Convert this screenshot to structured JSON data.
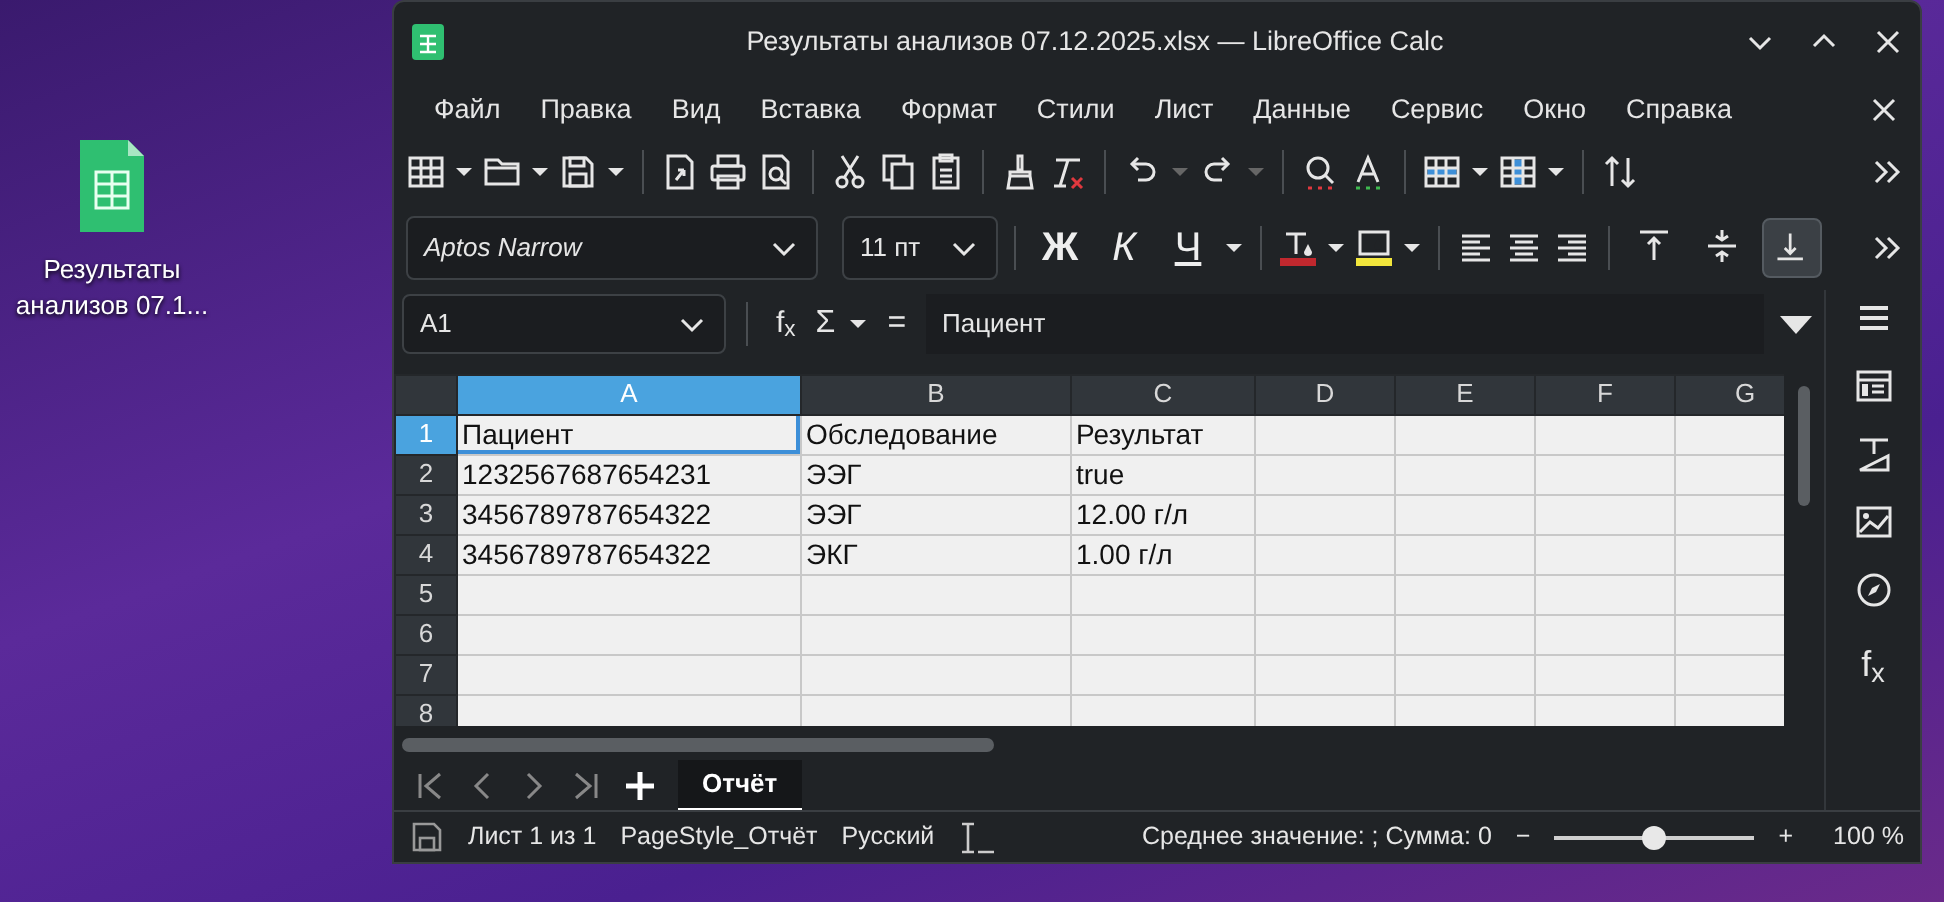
{
  "window": {
    "title": "Результаты анализов 07.12.2025.xlsx — LibreOffice Calc"
  },
  "desktop_icon": {
    "label": "Результаты анализов 07.1..."
  },
  "menu": [
    "Файл",
    "Правка",
    "Вид",
    "Вставка",
    "Формат",
    "Стили",
    "Лист",
    "Данные",
    "Сервис",
    "Окно",
    "Справка"
  ],
  "format_toolbar": {
    "font_name": "Aptos Narrow",
    "font_size": "11 пт",
    "text_styles": [
      {
        "kind": "bold",
        "label": "Ж"
      },
      {
        "kind": "italic",
        "label": "К"
      },
      {
        "kind": "underline",
        "label": "Ч"
      }
    ],
    "vertical_align": [
      {
        "selected": false
      },
      {
        "selected": false
      },
      {
        "selected": true
      }
    ]
  },
  "formula_bar": {
    "name_box": "A1",
    "function_wizard": "f$_{x}$",
    "sum": "Σ",
    "equals": "=",
    "content": "Пациент"
  },
  "columns": [
    {
      "label": "A",
      "selected": true
    },
    {
      "label": "B",
      "selected": false
    },
    {
      "label": "C",
      "selected": false
    },
    {
      "label": "D",
      "selected": false
    },
    {
      "label": "E",
      "selected": false
    },
    {
      "label": "F",
      "selected": false
    },
    {
      "label": "G",
      "selected": false
    }
  ],
  "rows": [
    {
      "number": "1",
      "selected": true,
      "cells": [
        "Пациент",
        "Обследование",
        "Результат"
      ]
    },
    {
      "number": "2",
      "selected": false,
      "cells": [
        "1232567687654231",
        "ЭЭГ",
        "true"
      ]
    },
    {
      "number": "3",
      "selected": false,
      "cells": [
        "3456789787654322",
        "ЭЭГ",
        "12.00 г/л"
      ]
    },
    {
      "number": "4",
      "selected": false,
      "cells": [
        "3456789787654322",
        "ЭКГ",
        "1.00 г/л"
      ]
    },
    {
      "number": "5",
      "selected": false
    },
    {
      "number": "6",
      "selected": false
    },
    {
      "number": "7",
      "selected": false
    },
    {
      "number": "8",
      "selected": false
    }
  ],
  "sidebar": {
    "functions": "f$_{x}$"
  },
  "sheet_tabs": [
    {
      "label": "Отчёт",
      "selected": true
    }
  ],
  "status_bar": {
    "sheet": "Лист 1 из 1",
    "page_style": "PageStyle_Отчёт",
    "language": "Русский",
    "summary": "Среднее значение: ; Сумма: 0",
    "zoom_out": "−",
    "zoom_in": "+",
    "zoom": {
      "level": 0.5
    },
    "zoom_percent": "100 %"
  }
}
